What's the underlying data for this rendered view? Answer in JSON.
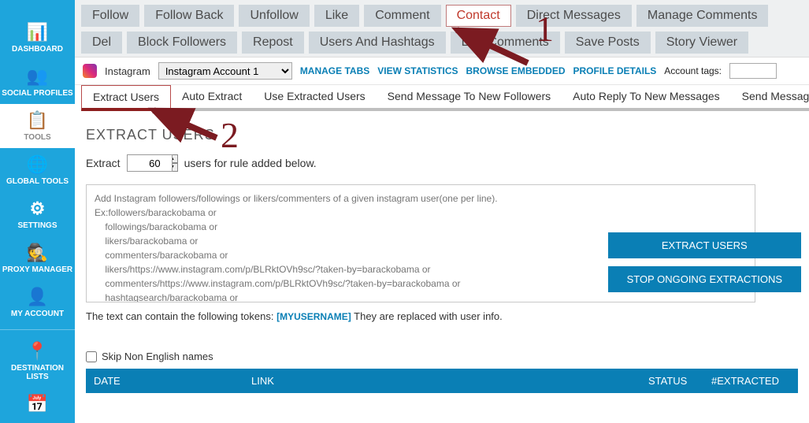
{
  "sidebar": {
    "items": [
      {
        "label": "DASHBOARD",
        "icon": "📊"
      },
      {
        "label": "SOCIAL PROFILES",
        "icon": "👥"
      },
      {
        "label": "TOOLS",
        "icon": "📋"
      },
      {
        "label": "GLOBAL TOOLS",
        "icon": "🌐"
      },
      {
        "label": "SETTINGS",
        "icon": "⚙"
      },
      {
        "label": "PROXY MANAGER",
        "icon": "🕵"
      },
      {
        "label": "MY ACCOUNT",
        "icon": "👤"
      },
      {
        "label": "DESTINATION LISTS",
        "icon": "📍"
      },
      {
        "label": "",
        "icon": "📅"
      }
    ]
  },
  "topTabs": {
    "row1": [
      "Follow",
      "Follow Back",
      "Unfollow",
      "Like",
      "Comment",
      "Contact",
      "Direct Messages",
      "Manage Comments",
      "Del"
    ],
    "row2": [
      "Block Followers",
      "Repost",
      "Users And Hashtags",
      "Like Comments",
      "Save Posts",
      "Story Viewer"
    ]
  },
  "accountBar": {
    "platform": "Instagram",
    "account": "Instagram Account 1",
    "manageTabs": "MANAGE TABS",
    "viewStats": "VIEW STATISTICS",
    "browseEmbedded": "BROWSE EMBEDDED",
    "profileDetails": "PROFILE DETAILS",
    "accountTagsLabel": "Account tags:"
  },
  "subTabs": [
    "Extract Users",
    "Auto Extract",
    "Use Extracted Users",
    "Send Message To New Followers",
    "Auto Reply To New Messages",
    "Send Messages"
  ],
  "section": {
    "title": "EXTRACT USERS",
    "extractLabel": "Extract",
    "extractValue": "60",
    "extractSuffix": "users for rule added below.",
    "placeholder": "Add Instagram followers/followings or likers/commenters of a given instagram user(one per line).\nEx:followers/barackobama or\n    followings/barackobama or\n    likers/barackobama or\n    commenters/barackobama or\n    likers/https://www.instagram.com/p/BLRktOVh9sc/?taken-by=barackobama or\n    commenters/https://www.instagram.com/p/BLRktOVh9sc/?taken-by=barackobama or\n    hashtagsearch/barackobama or\n    usersthattagged/barackobama or\n    specificuser/barackobama",
    "tokenLinePrefix": "The text can contain the following tokens:  ",
    "token": "[MYUSERNAME]",
    "tokenLineSuffix": "   They are replaced with user info.",
    "skipLabel": "Skip Non English names",
    "btnExtract": "EXTRACT USERS",
    "btnStop": "STOP ONGOING EXTRACTIONS"
  },
  "table": {
    "headers": [
      "DATE",
      "LINK",
      "STATUS",
      "#EXTRACTED"
    ]
  },
  "anno": {
    "one": "1",
    "two": "2"
  }
}
